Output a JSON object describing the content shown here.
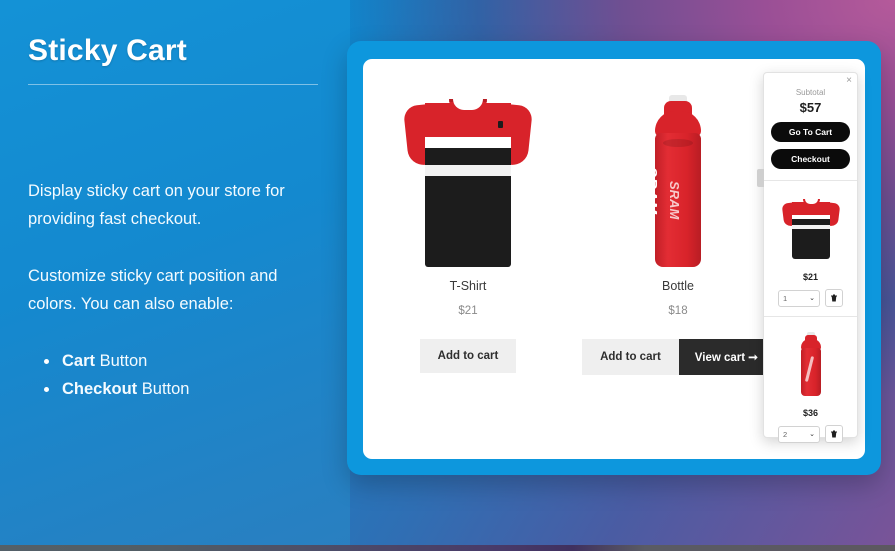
{
  "promo": {
    "title": "Sticky Cart",
    "paragraph_1": "Display sticky cart on your store for providing fast checkout.",
    "paragraph_2": "Customize sticky cart position and colors. You can also enable:",
    "features": [
      {
        "bold": "Cart",
        "rest": " Button"
      },
      {
        "bold": "Checkout",
        "rest": " Button"
      }
    ]
  },
  "shop": {
    "products": [
      {
        "name": "T-Shirt",
        "price": "$21",
        "add_label": "Add to cart",
        "image": "tshirt-red-black"
      },
      {
        "name": "Bottle",
        "price": "$18",
        "add_label": "Add to cart",
        "view_cart_label": "View cart",
        "view_cart_arrow": "➞",
        "image": "bottle-red-sram",
        "brand": "SRAM"
      }
    ]
  },
  "sticky_cart": {
    "close_icon": "×",
    "subtotal_label": "Subtotal",
    "subtotal_value": "$57",
    "go_to_cart_label": "Go To Cart",
    "checkout_label": "Checkout",
    "items": [
      {
        "price": "$21",
        "qty": "1",
        "chevron": "⌄",
        "image": "tshirt-red-black"
      },
      {
        "price": "$36",
        "qty": "2",
        "chevron": "⌄",
        "image": "bottle-red-sram"
      }
    ]
  },
  "colors": {
    "brand_blue": "#0d97dd",
    "panel_blue": "#1489cf",
    "accent_red": "#d8232a",
    "dark_button": "#2b2b2b"
  }
}
